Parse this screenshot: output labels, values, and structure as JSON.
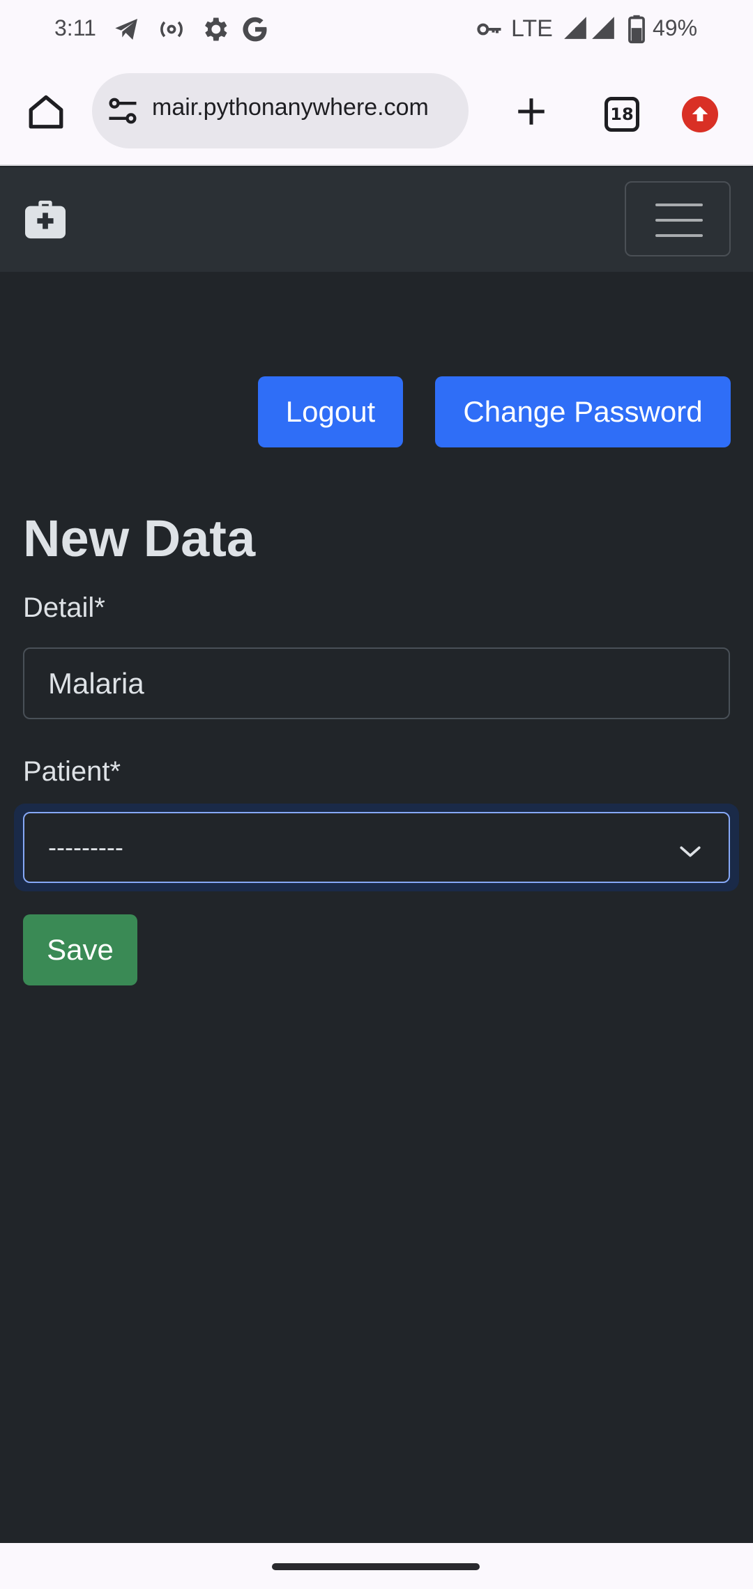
{
  "status_bar": {
    "time": "3:11",
    "network": "LTE",
    "battery": "49%",
    "icons": [
      "telegram-icon",
      "hotspot-icon",
      "settings-icon",
      "google-icon",
      "vpn-key-icon",
      "signal-icon",
      "signal-icon",
      "battery-icon"
    ]
  },
  "browser": {
    "url": "mair.pythonanywhere.com",
    "tab_count": "18"
  },
  "navbar": {
    "brand_icon": "medical-bag-icon",
    "toggler_icon": "hamburger-menu-icon"
  },
  "actions": {
    "logout_label": "Logout",
    "change_password_label": "Change Password"
  },
  "form": {
    "title": "New Data",
    "detail_label": "Detail*",
    "detail_value": "Malaria",
    "patient_label": "Patient*",
    "patient_selected": "---------",
    "save_label": "Save"
  },
  "colors": {
    "page_bg": "#212529",
    "navbar_bg": "#2b3035",
    "primary": "#2f6ef7",
    "success": "#3a8a55",
    "text": "#dee2e6"
  }
}
